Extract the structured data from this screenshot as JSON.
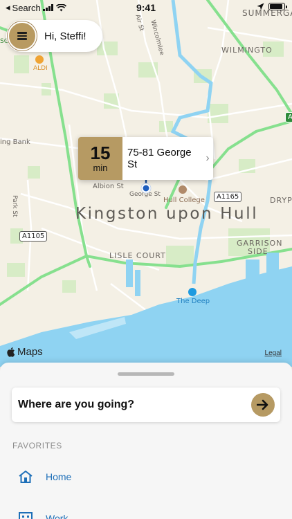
{
  "status_bar": {
    "back_label": "Search",
    "time": "9:41"
  },
  "greeting": {
    "text": "Hi, Steffi!"
  },
  "eta_callout": {
    "minutes": "15",
    "unit": "min",
    "address": "75-81 George St"
  },
  "map": {
    "city": "Kingston upon Hull",
    "labels": {
      "summergangs": "SUMMERGA",
      "wilmington": "WILMINGTO",
      "drypool": "DRYP",
      "garrison_side_1": "GARRISON",
      "garrison_side_2": "SIDE",
      "lisle_court": "LISLE COURT",
      "hull_college": "Hull College",
      "the_deep": "The Deep",
      "aldi": "ALDI",
      "albion_st": "Albion St",
      "george_st": "George St",
      "park_st": "Park St",
      "spring_bank": "ing Bank",
      "air_st": "Air St",
      "wincolmlee": "Wincolmlee",
      "sg": "SG"
    },
    "road_shields": {
      "a1105": "A1105",
      "a1165": "A1165",
      "a": "A"
    },
    "attribution": "Maps",
    "legal": "Legal"
  },
  "sheet": {
    "search_prompt": "Where are you going?",
    "favorites_title": "FAVORITES",
    "favorites": [
      {
        "label": "Home",
        "icon": "home-icon"
      },
      {
        "label": "Work",
        "icon": "work-icon"
      }
    ]
  },
  "colors": {
    "accent": "#b69a63",
    "link": "#1d6fb8",
    "water": "#8fd3f2",
    "road_green": "#86e08e"
  }
}
